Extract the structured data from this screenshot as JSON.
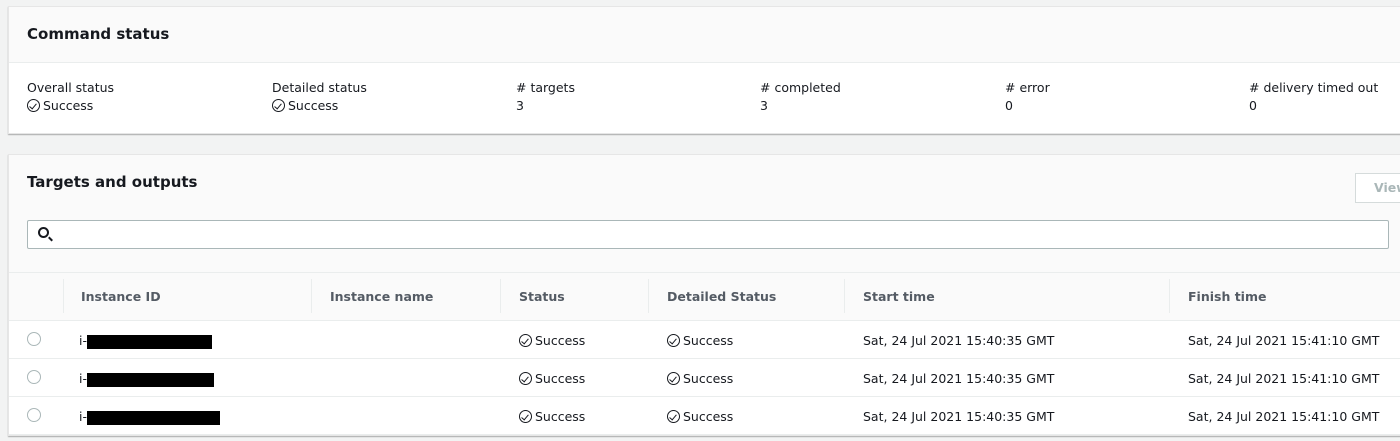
{
  "command_status": {
    "title": "Command status",
    "stats": [
      {
        "label": "Overall status",
        "value": "Success",
        "icon": "check-circle-icon"
      },
      {
        "label": "Detailed status",
        "value": "Success",
        "icon": "check-circle-icon"
      },
      {
        "label": "# targets",
        "value": "3"
      },
      {
        "label": "# completed",
        "value": "3"
      },
      {
        "label": "# error",
        "value": "0"
      },
      {
        "label": "# delivery timed out",
        "value": "0"
      }
    ]
  },
  "targets": {
    "title": "Targets and outputs",
    "view_button": "View",
    "search": {
      "value": "",
      "placeholder": ""
    },
    "columns": [
      "Instance ID",
      "Instance name",
      "Status",
      "Detailed Status",
      "Start time",
      "Finish time"
    ],
    "rows": [
      {
        "instance_id": "i-",
        "instance_name": "",
        "status": "Success",
        "detailed_status": "Success",
        "start": "Sat, 24 Jul 2021 15:40:35 GMT",
        "finish": "Sat, 24 Jul 2021 15:41:10 GMT"
      },
      {
        "instance_id": "i-",
        "instance_name": "",
        "status": "Success",
        "detailed_status": "Success",
        "start": "Sat, 24 Jul 2021 15:40:35 GMT",
        "finish": "Sat, 24 Jul 2021 15:41:10 GMT"
      },
      {
        "instance_id": "i-",
        "instance_name": "",
        "status": "Success",
        "detailed_status": "Success",
        "start": "Sat, 24 Jul 2021 15:40:35 GMT",
        "finish": "Sat, 24 Jul 2021 15:41:10 GMT"
      }
    ]
  }
}
